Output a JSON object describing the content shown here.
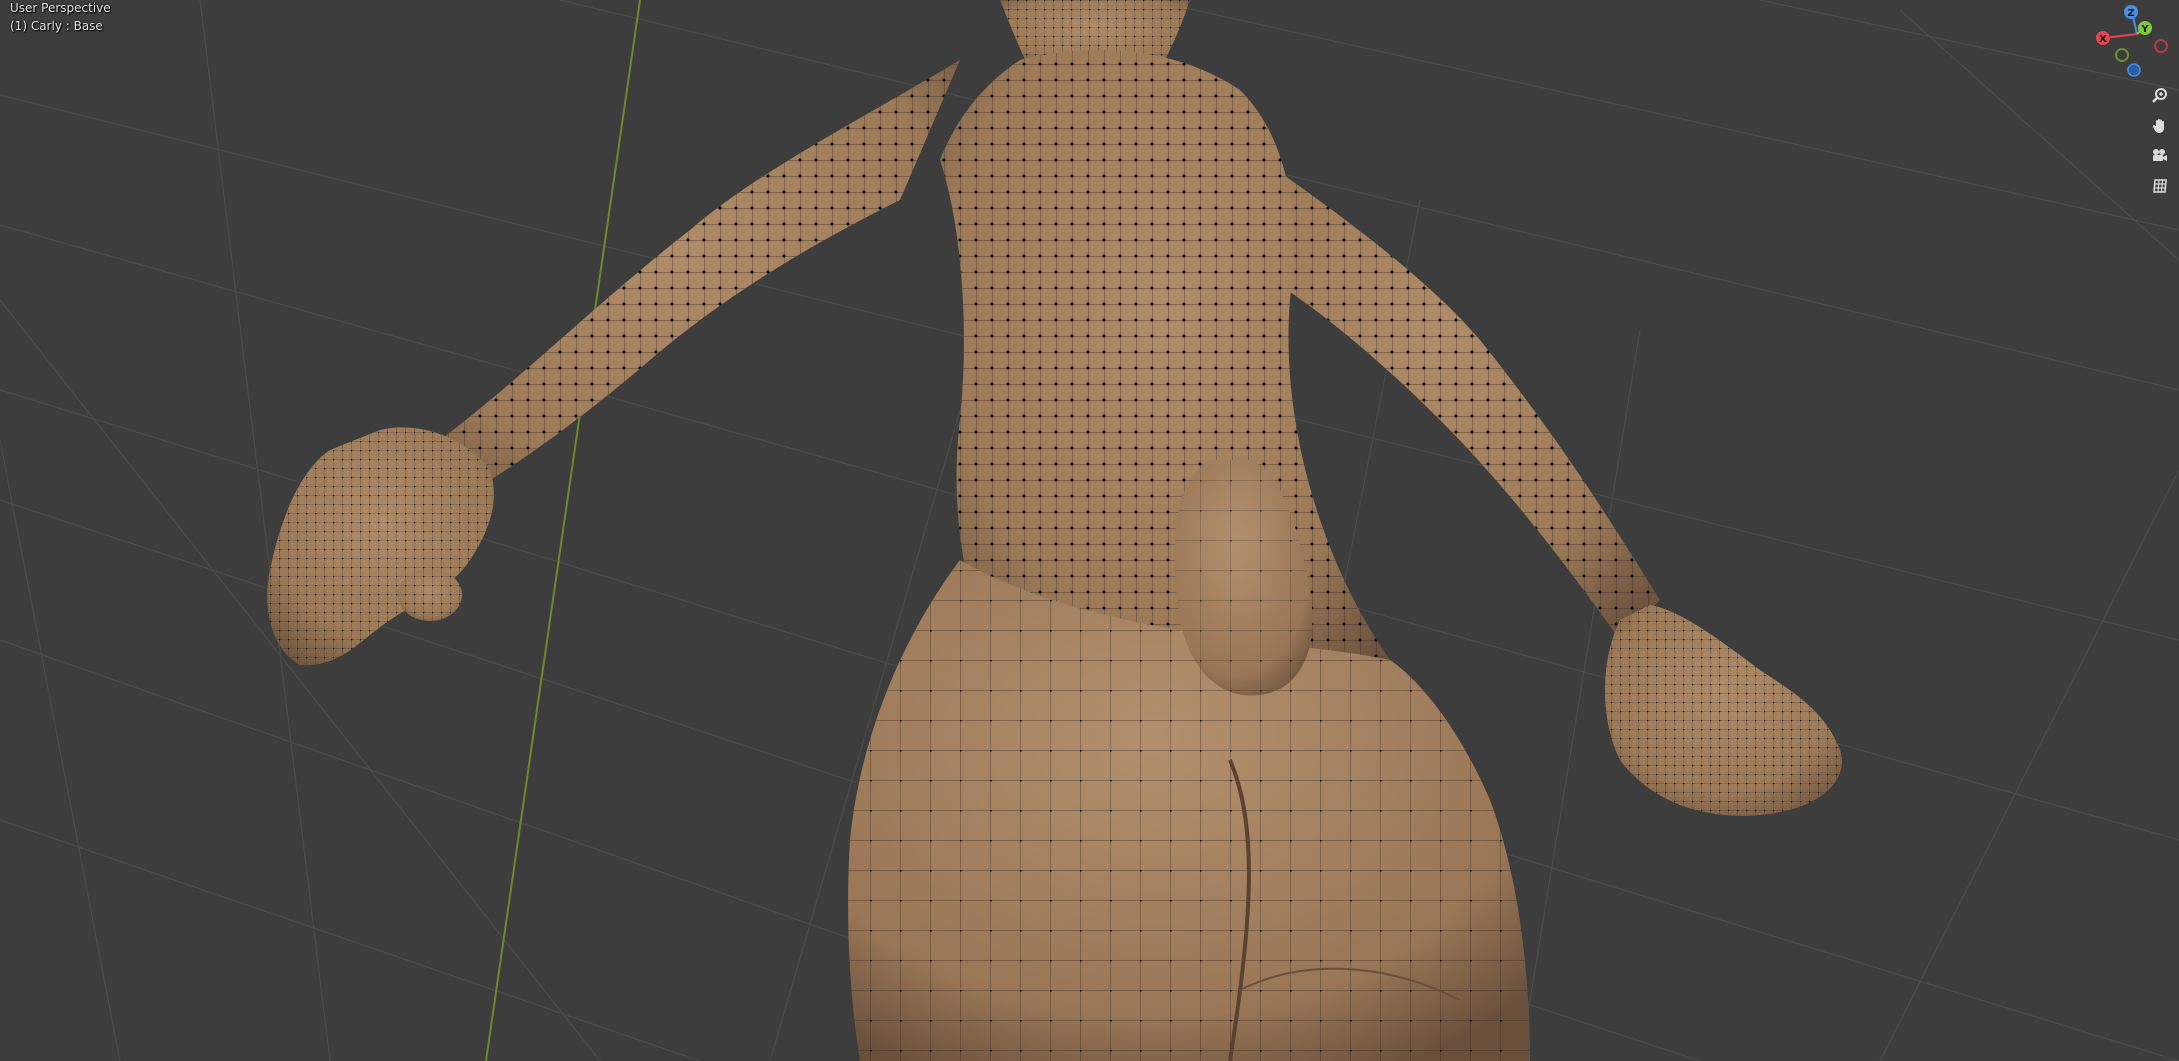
{
  "viewport": {
    "view_name": "User Perspective",
    "object_info": "(1) Carly : Base"
  },
  "gizmo": {
    "x_label": "X",
    "y_label": "Y",
    "z_label": "Z",
    "x_color": "#e34552",
    "y_color": "#7ec93b",
    "z_color": "#4a8ee6"
  },
  "nav_tools": [
    {
      "name": "zoom",
      "icon": "magnifier-icon"
    },
    {
      "name": "pan",
      "icon": "hand-icon"
    },
    {
      "name": "camera",
      "icon": "camera-icon"
    },
    {
      "name": "ortho",
      "icon": "grid-icon"
    }
  ],
  "colors": {
    "background": "#3d3d3d",
    "grid": "#4a4a4a",
    "y_axis": "#6b8a2c",
    "skin": "#a98563",
    "vertex": "#111111"
  }
}
